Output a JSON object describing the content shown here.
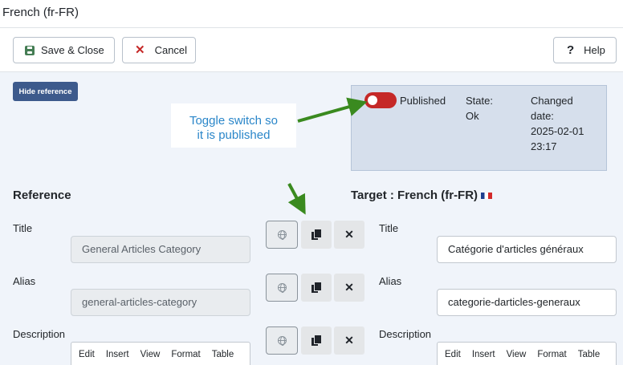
{
  "window": {
    "title": "French (fr-FR)"
  },
  "toolbar": {
    "save_label": "Save & Close",
    "cancel_label": "Cancel",
    "help_label": "Help"
  },
  "hide_reference_label": "Hide reference",
  "annotation": {
    "callout_line1": "Toggle switch so",
    "callout_line2": "it is published",
    "color": "#2a86c9",
    "arrow_color": "#3a8a1f"
  },
  "status": {
    "published_label": "Published",
    "published_on": false,
    "state_label": "State:",
    "state_value": "Ok",
    "changed_label_1": "Changed",
    "changed_label_2": "date:",
    "changed_date": "2025-02-01",
    "changed_time": "23:17"
  },
  "reference": {
    "heading": "Reference",
    "fields": [
      {
        "label": "Title",
        "value": "General Articles Category"
      },
      {
        "label": "Alias",
        "value": "general-articles-category"
      },
      {
        "label": "Description"
      }
    ]
  },
  "target": {
    "heading": "Target : French (fr-FR)",
    "fields": [
      {
        "label": "Title",
        "value": "Catégorie d'articles généraux"
      },
      {
        "label": "Alias",
        "value": "categorie-darticles-generaux"
      },
      {
        "label": "Description"
      }
    ]
  },
  "editor_menu": [
    "Edit",
    "Insert",
    "View",
    "Format",
    "Table"
  ],
  "colors": {
    "accent": "#3d5a8c",
    "danger": "#c52827",
    "save": "#457d54"
  }
}
